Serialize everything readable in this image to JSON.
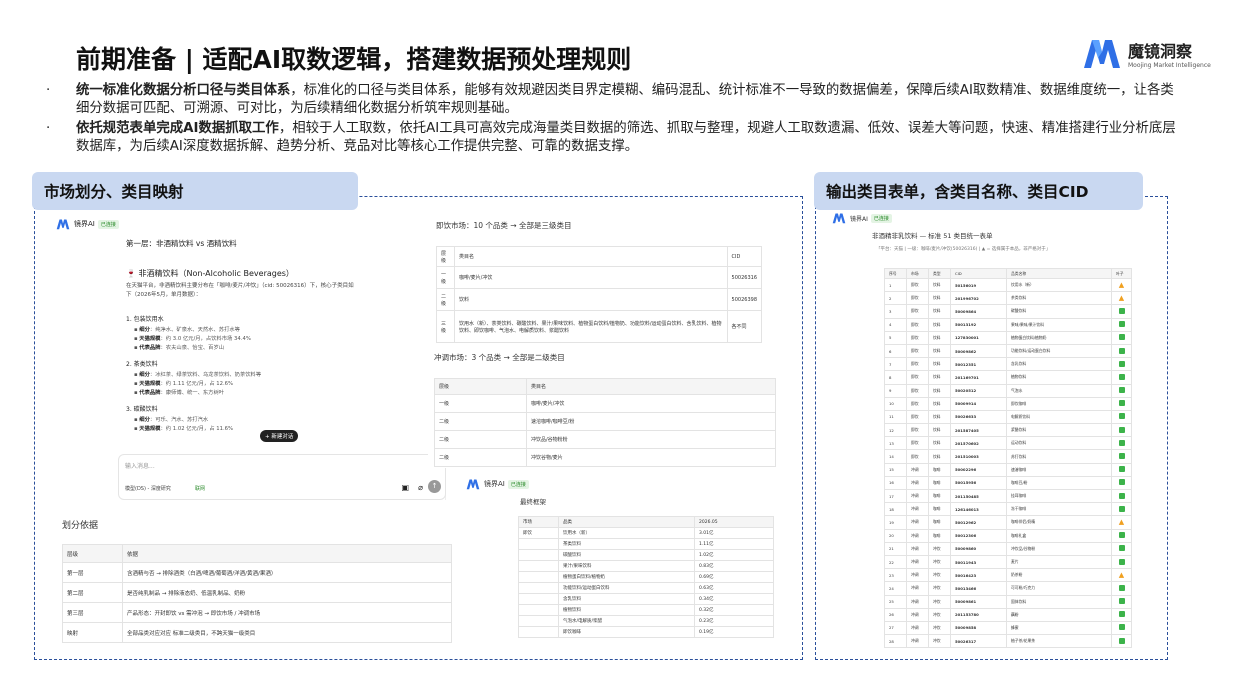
{
  "header": {
    "title": "前期准备 | 适配AI取数逻辑，搭建数据预处理规则",
    "logo_cn": "魔镜洞察",
    "logo_en": "Moojing Market Intelligence"
  },
  "bullets": [
    {
      "dot": "·",
      "bold": "统一标准化数据分析口径与类目体系",
      "rest": "，标准化的口径与类目体系，能够有效规避因类目界定模糊、编码混乱、统计标准不一导致的数据偏差，保障后续AI取数精准、数据维度统一，让各类细分数据可匹配、可溯源、可对比，为后续精细化数据分析筑牢规则基础。"
    },
    {
      "dot": "·",
      "bold": "依托规范表单完成AI数据抓取工作",
      "rest": "，相较于人工取数，依托AI工具可高效完成海量类目数据的筛选、抓取与整理，规避人工取数遗漏、低效、误差大等问题，快速、精准搭建行业分析底层数据库，为后续AI深度数据拆解、趋势分析、竞品对比等核心工作提供完整、可靠的数据支撑。"
    }
  ],
  "left_tag": "市场划分、类目映射",
  "right_tag": "输出类目表单，含类目名称、类目CID",
  "chat": {
    "app_name": "镜界AI",
    "badge": "已连接",
    "layer_title": "第一层：非酒精饮料 vs 酒精饮料",
    "section_title": "🍷 非酒精饮料（Non-Alcoholic Beverages）",
    "intro": "在天猫平台，非酒精饮料主要分布在「咖啡/麦片/冲饮」（cid: 50026316）下，核心子类目如下（2026年5月，单月数据）：",
    "groups": [
      {
        "name": "1. 包装饮用水",
        "items": [
          [
            "细分",
            "纯净水、矿泉水、天然水、苏打水等"
          ],
          [
            "天猫规模",
            "约 3.0 亿元/月，占饮料市场 34.4%"
          ],
          [
            "代表品牌",
            "农夫山泉、怡宝、百岁山"
          ]
        ]
      },
      {
        "name": "2. 茶类饮料",
        "items": [
          [
            "细分",
            "冰红茶、绿茶饮料、乌龙茶饮料、奶茶饮料等"
          ],
          [
            "天猫规模",
            "约 1.11 亿元/月，占 12.6%"
          ],
          [
            "代表品牌",
            "康师傅、统一、东方树叶"
          ]
        ]
      },
      {
        "name": "3. 碳酸饮料",
        "items": [
          [
            "细分",
            "可乐、汽水、苏打汽水"
          ],
          [
            "天猫规模",
            "约 1.02 亿元/月，占 11.6%"
          ]
        ]
      }
    ],
    "new_chat_button": "+ 新建对话",
    "input_placeholder": "输入消息...",
    "model_select": "模型(DS) - 深度研究",
    "mode_tag": "联网"
  },
  "basis": {
    "title": "划分依据",
    "headers": [
      "层级",
      "依据"
    ],
    "rows": [
      [
        "第一层",
        "含酒精与否 → 排除酒类（白酒/啤酒/葡萄酒/洋酒/黄酒/果酒）"
      ],
      [
        "第二层",
        "是否纯乳制品 → 排除液态奶、低温乳制品、奶粉"
      ],
      [
        "第三层",
        "产品形态：开封即饮 vs 需冲泡 → 即饮市场 / 冲调市场"
      ],
      [
        "映射",
        "全部品类对应对应 标准二级类目，不跨天猫一级类目"
      ]
    ]
  },
  "drink_market": {
    "title": "即饮市场：10 个品类 → 全部是三级类目",
    "headers": [
      "层级",
      "类目名",
      "CID"
    ],
    "rows": [
      [
        "一级",
        "咖啡/麦片/冲饮",
        "50026316"
      ],
      [
        "二级",
        "饮料",
        "50026398"
      ],
      [
        "三级",
        "饮用水（新）、茶类饮料、碳酸饮料、果汁/果味饮料、植物蛋白饮料/植物奶、功能饮料/运动蛋白饮料、含乳饮料、植物饮料、即饮咖啡、气泡水、电解质饮料、浆醋饮料",
        "各不同"
      ]
    ]
  },
  "brew_market": {
    "title": "冲调市场：3 个品类 → 全部是二级类目",
    "headers": [
      "层级",
      "类目名"
    ],
    "rows": [
      [
        "一级",
        "咖啡/麦片/冲饮"
      ],
      [
        "二级",
        "速溶咖啡/咖啡豆/粉"
      ],
      [
        "二级",
        "冲饮品/谷物粉粉"
      ],
      [
        "二级",
        "冲饮谷物/麦片"
      ]
    ]
  },
  "framework": {
    "app_name": "镜界AI",
    "badge": "已连接",
    "title": "最终框架",
    "headers": [
      "市场",
      "品类",
      "2026.05"
    ],
    "market": "即饮",
    "rows": [
      [
        "饮用水（新）",
        "3.01亿"
      ],
      [
        "茶类饮料",
        "1.11亿"
      ],
      [
        "碳酸饮料",
        "1.02亿"
      ],
      [
        "果汁/果味饮料",
        "0.83亿"
      ],
      [
        "植物蛋白饮料/植物奶",
        "0.69亿"
      ],
      [
        "功能饮料/运动蛋白饮料",
        "0.63亿"
      ],
      [
        "含乳饮料",
        "0.34亿"
      ],
      [
        "植物饮料",
        "0.32亿"
      ],
      [
        "气泡水/电解质/浆醋",
        "0.23亿"
      ],
      [
        "即饮咖啡",
        "0.19亿"
      ]
    ]
  },
  "cid_table": {
    "app_name": "镜界AI",
    "badge": "已连接",
    "title": "非酒精非乳饮料 — 标准 51 类目统一表单",
    "note": "「平台：天猫 | 一级：咖啡/麦片/冲饮(50026316) | ▲ = 选择属于本品，非严格对于」",
    "headers": [
      "序号",
      "市场",
      "类型",
      "CID",
      "品类名称",
      "叶子"
    ],
    "rows": [
      [
        "1",
        "即饮",
        "饮料",
        "50156019",
        "饮用水（新）",
        "w"
      ],
      [
        "2",
        "即饮",
        "饮料",
        "201996702",
        "茶类饮料",
        "w"
      ],
      [
        "3",
        "即饮",
        "饮料",
        "50009864",
        "碳酸饮料",
        "c"
      ],
      [
        "4",
        "即饮",
        "饮料",
        "50013192",
        "果味/果味/果汁饮料",
        "c"
      ],
      [
        "5",
        "即饮",
        "饮料",
        "127830001",
        "植物蛋白饮料/植物奶",
        "c"
      ],
      [
        "6",
        "即饮",
        "饮料",
        "50009862",
        "功能饮料/运动蛋白饮料",
        "c"
      ],
      [
        "7",
        "即饮",
        "饮料",
        "50012351",
        "含乳饮料",
        "c"
      ],
      [
        "8",
        "即饮",
        "饮料",
        "201169701",
        "植物饮料",
        "c"
      ],
      [
        "9",
        "即饮",
        "饮料",
        "50020512",
        "气泡水",
        "c"
      ],
      [
        "10",
        "即饮",
        "饮料",
        "50009914",
        "即饮咖啡",
        "c"
      ],
      [
        "11",
        "即饮",
        "饮料",
        "50026633",
        "电解质饮料",
        "c"
      ],
      [
        "12",
        "即饮",
        "饮料",
        "201587405",
        "浆醋饮料",
        "c"
      ],
      [
        "13",
        "即饮",
        "饮料",
        "201570602",
        "运动饮料",
        "c"
      ],
      [
        "14",
        "即饮",
        "饮料",
        "201510003",
        "苏打饮料",
        "c"
      ],
      [
        "15",
        "冲调",
        "咖啡",
        "50002296",
        "速溶咖啡",
        "c"
      ],
      [
        "16",
        "冲调",
        "咖啡",
        "50015956",
        "咖啡豆/粉",
        "c"
      ],
      [
        "17",
        "冲调",
        "咖啡",
        "201150485",
        "挂耳咖啡",
        "c"
      ],
      [
        "18",
        "冲调",
        "咖啡",
        "126146013",
        "冻干咖啡",
        "c"
      ],
      [
        "19",
        "冲调",
        "咖啡",
        "50012962",
        "咖啡伴侣/奶精",
        "w"
      ],
      [
        "20",
        "冲调",
        "咖啡",
        "50012306",
        "咖啡礼盒",
        "c"
      ],
      [
        "21",
        "冲调",
        "冲饮",
        "50009860",
        "冲饮品/谷物粉",
        "c"
      ],
      [
        "22",
        "冲调",
        "冲饮",
        "50011943",
        "麦片",
        "c"
      ],
      [
        "23",
        "冲调",
        "冲饮",
        "50016423",
        "奶茶粉",
        "w"
      ],
      [
        "24",
        "冲调",
        "冲饮",
        "50013466",
        "可可粉/巧克力",
        "c"
      ],
      [
        "25",
        "冲调",
        "冲饮",
        "50009861",
        "固体饮料",
        "c"
      ],
      [
        "26",
        "冲调",
        "冲饮",
        "201153780",
        "藕粉",
        "c"
      ],
      [
        "27",
        "冲调",
        "冲饮",
        "50009858",
        "蜂蜜",
        "c"
      ],
      [
        "28",
        "冲调",
        "冲饮",
        "50026317",
        "柚子茶/花果茶",
        "c"
      ]
    ]
  }
}
